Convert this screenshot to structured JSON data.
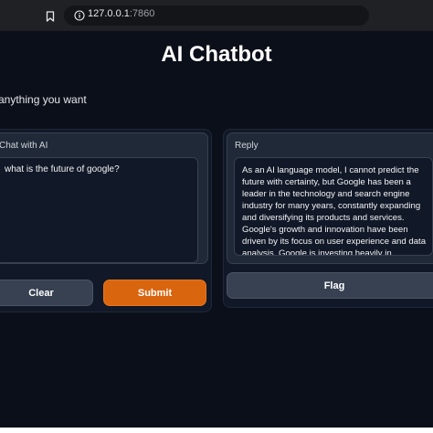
{
  "browser": {
    "url_host": "127.0.0.1",
    "url_port": ":7860"
  },
  "app": {
    "title": "AI Chatbot",
    "description": "anything you want"
  },
  "input": {
    "label": "Chat with AI",
    "value": "what is the future of google?"
  },
  "output": {
    "label": "Reply",
    "value": "As an AI language model, I cannot predict the future with certainty, but Google has been a leader in the technology and search engine industry for many years, constantly expanding and diversifying its products and services. Google's growth and innovation have been driven by its focus on user experience and data analysis. Google is investing heavily in emerging technologies like artificial"
  },
  "buttons": {
    "clear": "Clear",
    "submit": "Submit",
    "flag": "Flag"
  },
  "colors": {
    "background": "#0b0f19",
    "panel": "#111827",
    "block": "#1f2937",
    "secondary_button": "#374151",
    "primary_button": "#d9650f"
  }
}
